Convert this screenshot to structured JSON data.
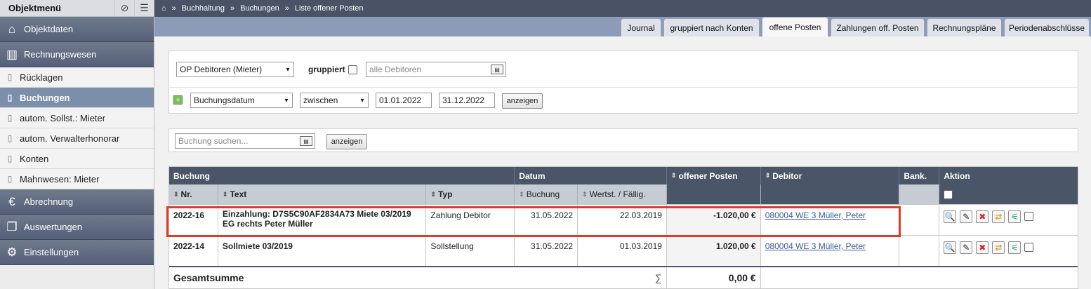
{
  "sidebar": {
    "title": "Objektmenü",
    "sections": [
      {
        "label": "Objektdaten",
        "icon": "house-icon"
      },
      {
        "label": "Rechnungswesen",
        "icon": "ledger-icon"
      }
    ],
    "items": [
      {
        "label": "Rücklagen"
      },
      {
        "label": "Buchungen"
      },
      {
        "label": "autom. Sollst.: Mieter"
      },
      {
        "label": "autom. Verwalterhonorar"
      },
      {
        "label": "Konten"
      },
      {
        "label": "Mahnwesen: Mieter"
      }
    ],
    "bottom_sections": [
      {
        "label": "Abrechnung",
        "icon": "euro-icon"
      },
      {
        "label": "Auswertungen",
        "icon": "documents-icon"
      },
      {
        "label": "Einstellungen",
        "icon": "gears-icon"
      }
    ]
  },
  "breadcrumb": [
    "Buchhaltung",
    "Buchungen",
    "Liste offener Posten"
  ],
  "tabs": [
    {
      "label": "Journal"
    },
    {
      "label": "gruppiert nach Konten"
    },
    {
      "label": "offene Posten"
    },
    {
      "label": "Zahlungen off. Posten"
    },
    {
      "label": "Rechnungspläne"
    },
    {
      "label": "Periodenabschlüsse"
    }
  ],
  "filter": {
    "op_select": "OP Debitoren (Mieter)",
    "grouped_label": "gruppiert",
    "debitor_placeholder": "alle Debitoren",
    "date_field": "Buchungsdatum",
    "operator": "zwischen",
    "date_from": "01.01.2022",
    "date_to": "31.12.2022",
    "show_label": "anzeigen"
  },
  "search": {
    "placeholder": "Buchung suchen...",
    "show_label": "anzeigen"
  },
  "table": {
    "group_headers": [
      "Buchung",
      "Datum",
      "offener Posten",
      "Debitor",
      "Bank.",
      "Aktion"
    ],
    "col_headers": [
      "Nr.",
      "Text",
      "Typ",
      "Buchung",
      "Wertst. / Fällig."
    ],
    "rows": [
      {
        "nr": "2022-16",
        "text": "Einzahlung: D7S5C90AF2834A73 Miete 03/2019 EG rechts Peter Müller",
        "typ": "Zahlung Debitor",
        "buchung": "31.05.2022",
        "wertst": "22.03.2019",
        "offen": "-1.020,00 €",
        "debitor": "080004 WE 3 Müller, Peter"
      },
      {
        "nr": "2022-14",
        "text": "Sollmiete 03/2019",
        "typ": "Sollstellung",
        "buchung": "31.05.2022",
        "wertst": "01.03.2019",
        "offen": "1.020,00 €",
        "debitor": "080004 WE 3 Müller, Peter"
      }
    ],
    "sum_label": "Gesamtsumme",
    "sum_symbol": "∑",
    "sum_value": "0,00 €"
  },
  "colors": {
    "accent": "#4b5568",
    "highlight": "#e03a28",
    "active_item": "#7c8faa"
  }
}
